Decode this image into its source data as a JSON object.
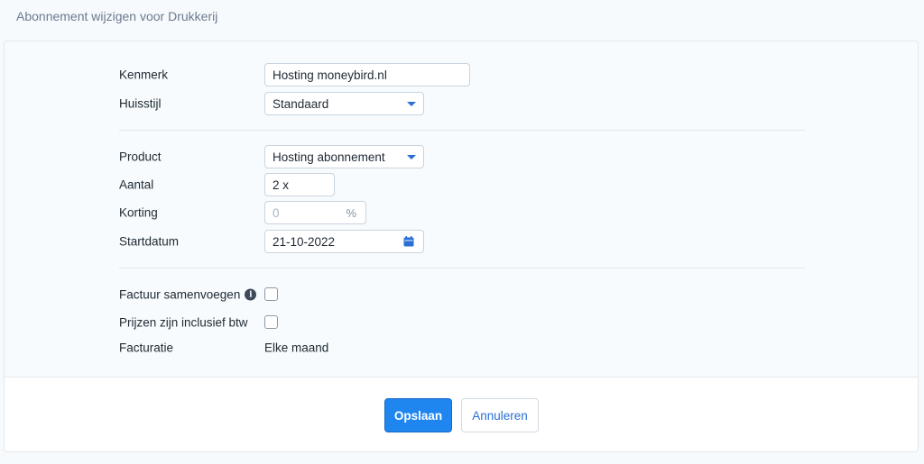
{
  "page": {
    "title": "Abonnement wijzigen voor Drukkerij"
  },
  "form": {
    "kenmerk": {
      "label": "Kenmerk",
      "value": "Hosting moneybird.nl"
    },
    "huisstijl": {
      "label": "Huisstijl",
      "value": "Standaard"
    },
    "product": {
      "label": "Product",
      "value": "Hosting abonnement"
    },
    "aantal": {
      "label": "Aantal",
      "value": "2 x"
    },
    "korting": {
      "label": "Korting",
      "placeholder": "0",
      "suffix": "%"
    },
    "startdatum": {
      "label": "Startdatum",
      "value": "21-10-2022",
      "icon": "calendar-icon"
    },
    "factuur_samenvoegen": {
      "label": "Factuur samenvoegen",
      "info_icon": "i",
      "checked": false
    },
    "prijzen_incl_btw": {
      "label": "Prijzen zijn inclusief btw",
      "checked": false
    },
    "facturatie": {
      "label": "Facturatie",
      "value": "Elke maand"
    }
  },
  "actions": {
    "save_label": "Opslaan",
    "cancel_label": "Annuleren"
  },
  "colors": {
    "accent": "#1f86f0",
    "link": "#2a6fd6"
  }
}
